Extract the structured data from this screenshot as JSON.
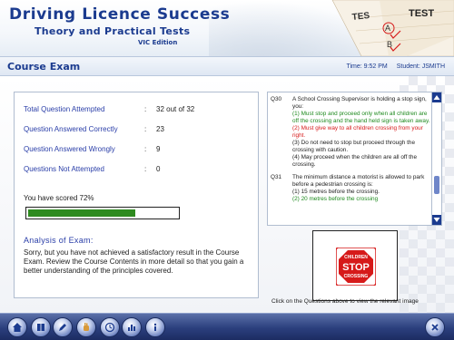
{
  "header": {
    "title": "Driving Licence Success",
    "subtitle": "Theory and Practical Tests",
    "edition": "VIC Edition",
    "art_words": [
      "TES",
      "TEST",
      "A",
      "B"
    ]
  },
  "section": {
    "title": "Course Exam",
    "time": "Time: 9:52 PM",
    "student": "Student: JSMITH"
  },
  "results": {
    "stats": [
      {
        "label": "Total Question Attempted",
        "value": "32 out of 32"
      },
      {
        "label": "Question Answered  Correctly",
        "value": "23"
      },
      {
        "label": "Question Answered Wrongly",
        "value": "9"
      },
      {
        "label": "Questions Not Attempted",
        "value": "0"
      }
    ],
    "colon": ":",
    "score_text": "You have scored 72%",
    "score_fraction": 0.72,
    "analysis_heading": "Analysis of Exam:",
    "analysis_text": "Sorry, but you have not achieved a satisfactory result in the Course Exam. Review the Course Contents in more detail so that you gain a better understanding of the principles covered."
  },
  "questions": [
    {
      "number": "Q30",
      "text": "A School Crossing Supervisor is holding a stop sign, you:",
      "options": [
        {
          "text": "(1) Must stop and proceed only when all children are off the crossing and the hand held sign is taken away.",
          "status": "correct"
        },
        {
          "text": "(2) Must give way to all children crossing from your right.",
          "status": "wrong"
        },
        {
          "text": "(3) Do not need to stop but proceed through the crossing with caution.",
          "status": "neutral"
        },
        {
          "text": "(4) May proceed when the children are all off the crossing.",
          "status": "neutral"
        }
      ]
    },
    {
      "number": "Q31",
      "text": "The minimum distance a motorist is allowed to park before a pedestrian crossing is:",
      "options": [
        {
          "text": "(1) 15 metres before the crossing.",
          "status": "neutral"
        },
        {
          "text": "(2) 20 metres before the crossing",
          "status": "correct"
        }
      ]
    }
  ],
  "sign_image": {
    "words": [
      "CHILDREN",
      "STOP",
      "CROSSING"
    ]
  },
  "click_hint": "Click on the Questions above to view the  relevant image",
  "toolbar": {
    "buttons": [
      "home-icon",
      "book-icon",
      "pencil-icon",
      "hand-icon",
      "clock-icon",
      "chart-icon",
      "info-icon"
    ],
    "exit_icon": "close-icon"
  },
  "colors": {
    "brand": "#1b3b8f",
    "correct": "#1f8a1f",
    "wrong": "#d61a1a",
    "progress": "#2e8a1f"
  }
}
